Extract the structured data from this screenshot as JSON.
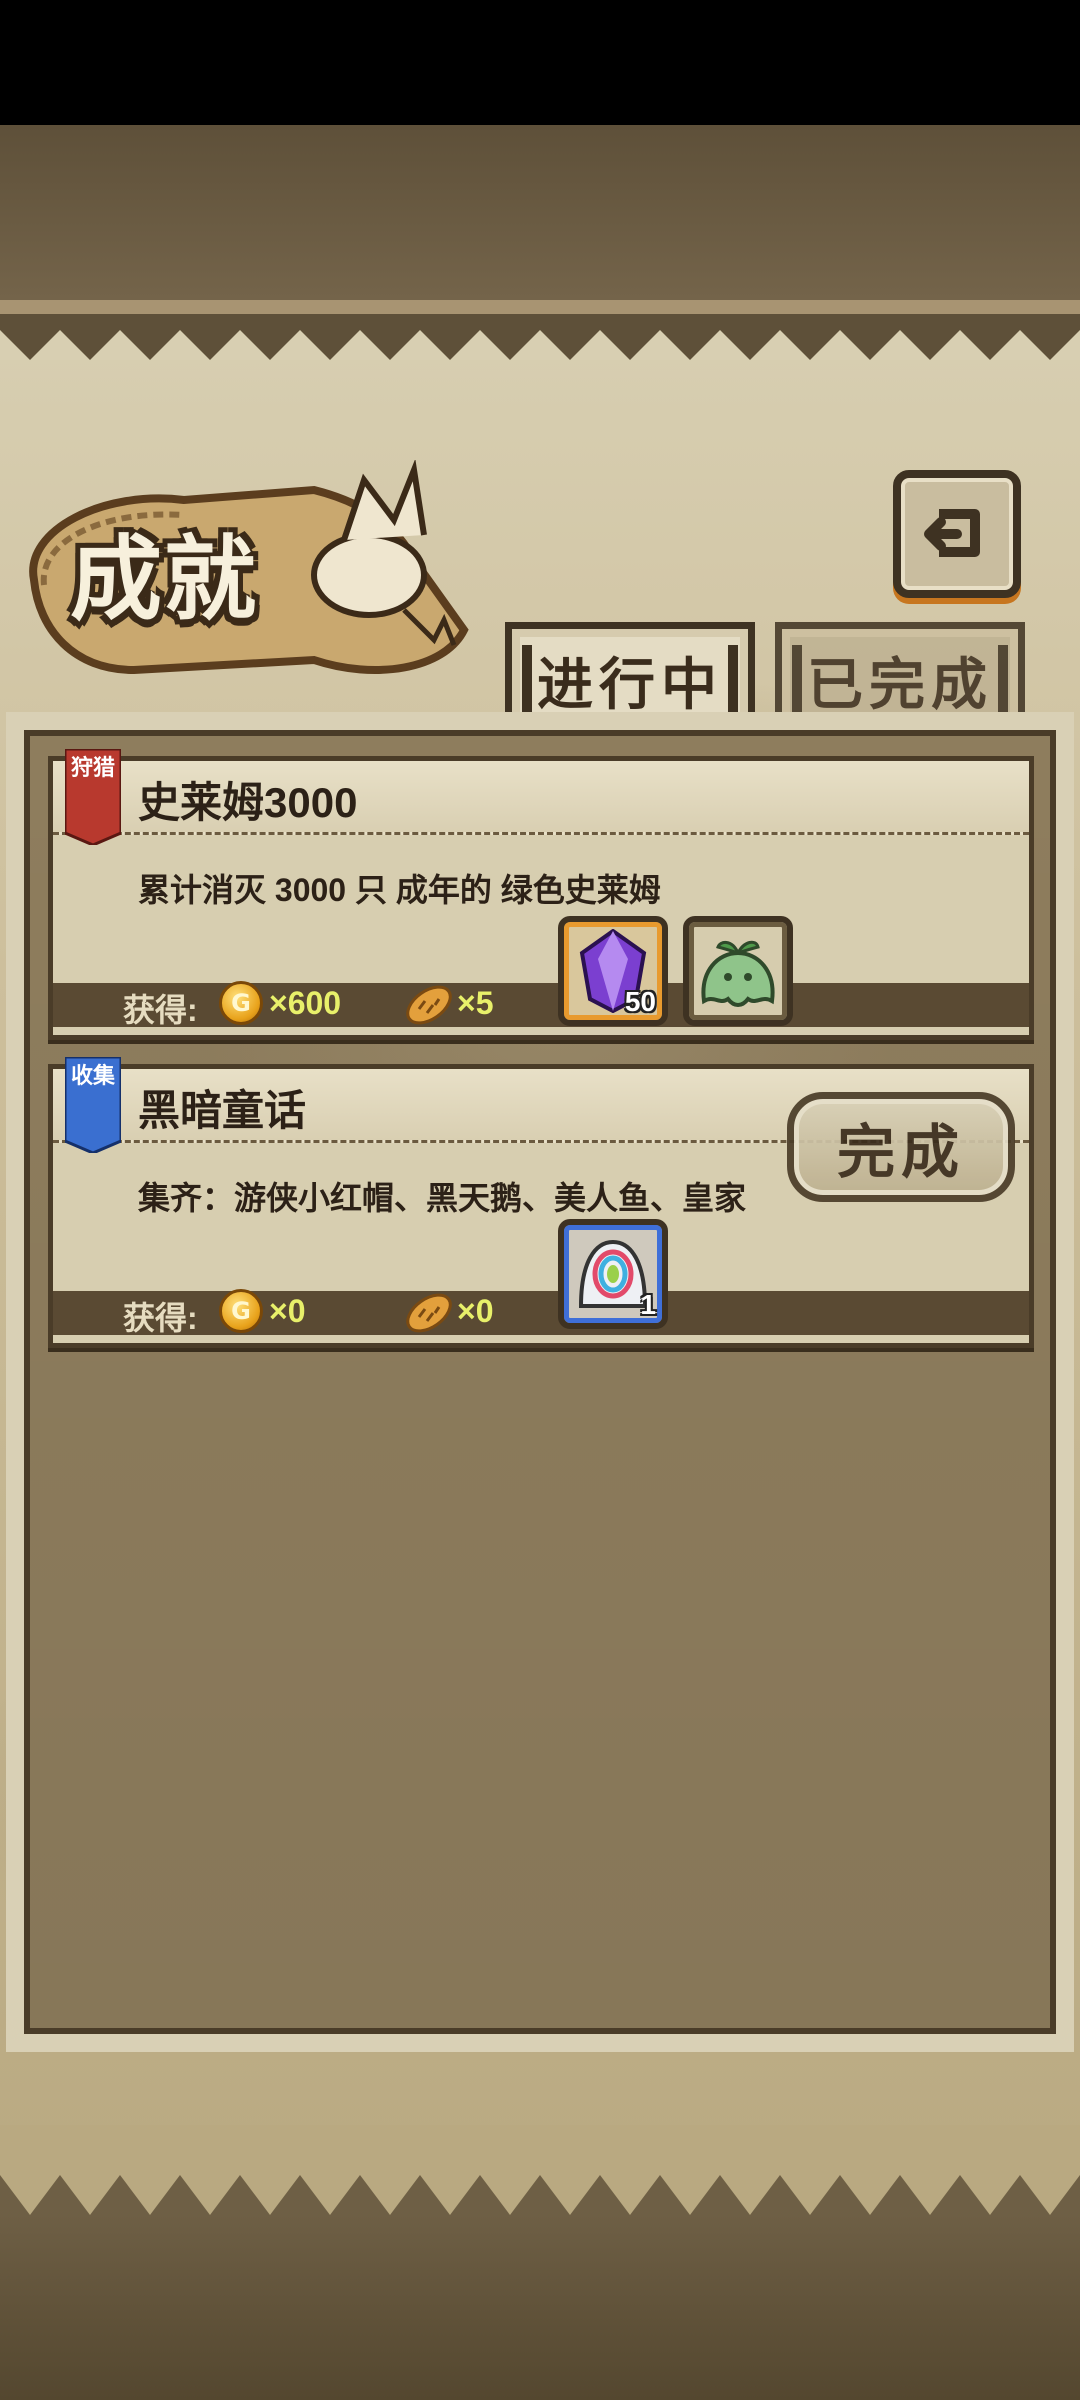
{
  "screen_title": "成就",
  "tabs": [
    {
      "label": "进行中",
      "active": true
    },
    {
      "label": "已完成",
      "active": false
    }
  ],
  "back_icon": "back-arrow-icon",
  "achievements": [
    {
      "tag": "狩猎",
      "tag_color": "#b8392e",
      "title": "史莱姆3000",
      "description": "累计消灭 3000 只 成年的 绿色史莱姆",
      "reward_label": "获得:",
      "coin_count": "×600",
      "bread_count": "×5",
      "items": [
        {
          "icon": "purple-crystal-icon",
          "badge": "50",
          "frame": "gold"
        },
        {
          "icon": "green-slime-icon",
          "badge": "",
          "frame": "plain"
        }
      ]
    },
    {
      "tag": "收集",
      "tag_color": "#3a6fd0",
      "title": "黑暗童话",
      "description": "集齐：游侠小红帽、黑天鹅、美人鱼、皇家",
      "reward_label": "获得:",
      "coin_count": "×0",
      "bread_count": "×0",
      "stamp": "完成",
      "items": [
        {
          "icon": "rainbow-egg-icon",
          "badge": "1",
          "frame": "blue"
        }
      ]
    }
  ],
  "coin_glyph": "G"
}
